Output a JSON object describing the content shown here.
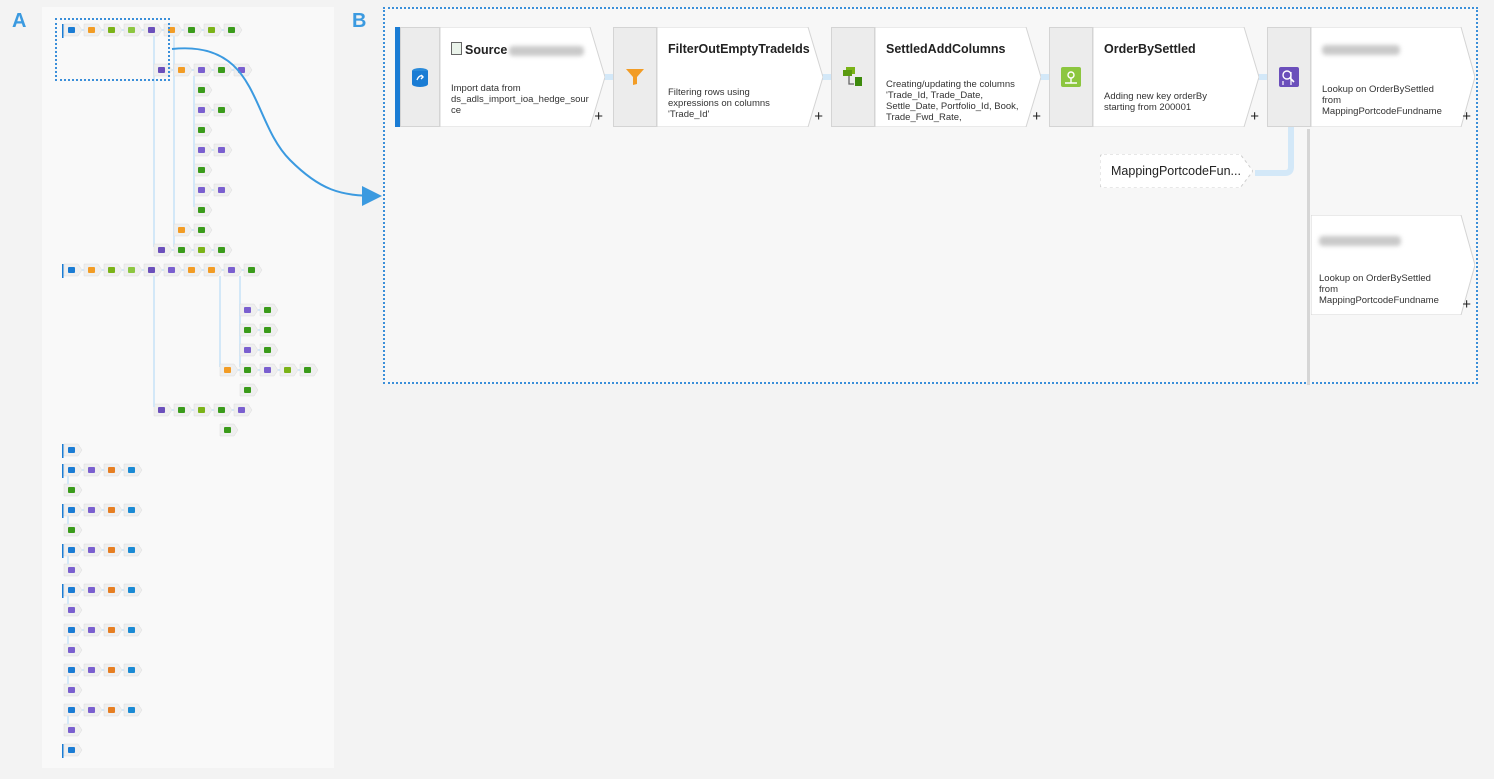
{
  "labels": {
    "overview": "A",
    "detail": "B"
  },
  "colors": {
    "accent": "#3b9ae0",
    "selection": "#3b8fd9",
    "link": "#d3e8f8",
    "source_bar": "#1a7cd4"
  },
  "flow": {
    "nodes": [
      {
        "id": "source",
        "icon": "source-icon",
        "title": "Source",
        "title_obscured": true,
        "description": "Import data from\nds_adls_import_ioa_hedge_sour\nce",
        "plus": "+"
      },
      {
        "id": "filter",
        "icon": "filter-icon",
        "title": "FilterOutEmptyTradeIds",
        "description": "Filtering rows using\nexpressions on columns\n'Trade_Id'",
        "plus": "+"
      },
      {
        "id": "derive",
        "icon": "derived-column-icon",
        "title": "SettledAddColumns",
        "description": "Creating/updating the columns\n'Trade_Id, Trade_Date,\nSettle_Date, Portfolio_Id, Book,\nTrade_Fwd_Rate,",
        "plus": "+"
      },
      {
        "id": "surrogate",
        "icon": "surrogate-key-icon",
        "title": "OrderBySettled",
        "description": "Adding new key orderBy\nstarting from 200001",
        "plus": "+"
      },
      {
        "id": "lookup1",
        "icon": "lookup-icon",
        "title": "",
        "title_obscured": true,
        "description": "Lookup on OrderBySettled\nfrom\nMappingPortcodeFundname",
        "plus": "+"
      },
      {
        "id": "lookup2",
        "title": "",
        "title_obscured": true,
        "description": "Lookup on OrderBySettled\nfrom\nMappingPortcodeFundname",
        "plus": "+"
      }
    ],
    "reference": {
      "label": "MappingPortcodeFun..."
    }
  }
}
